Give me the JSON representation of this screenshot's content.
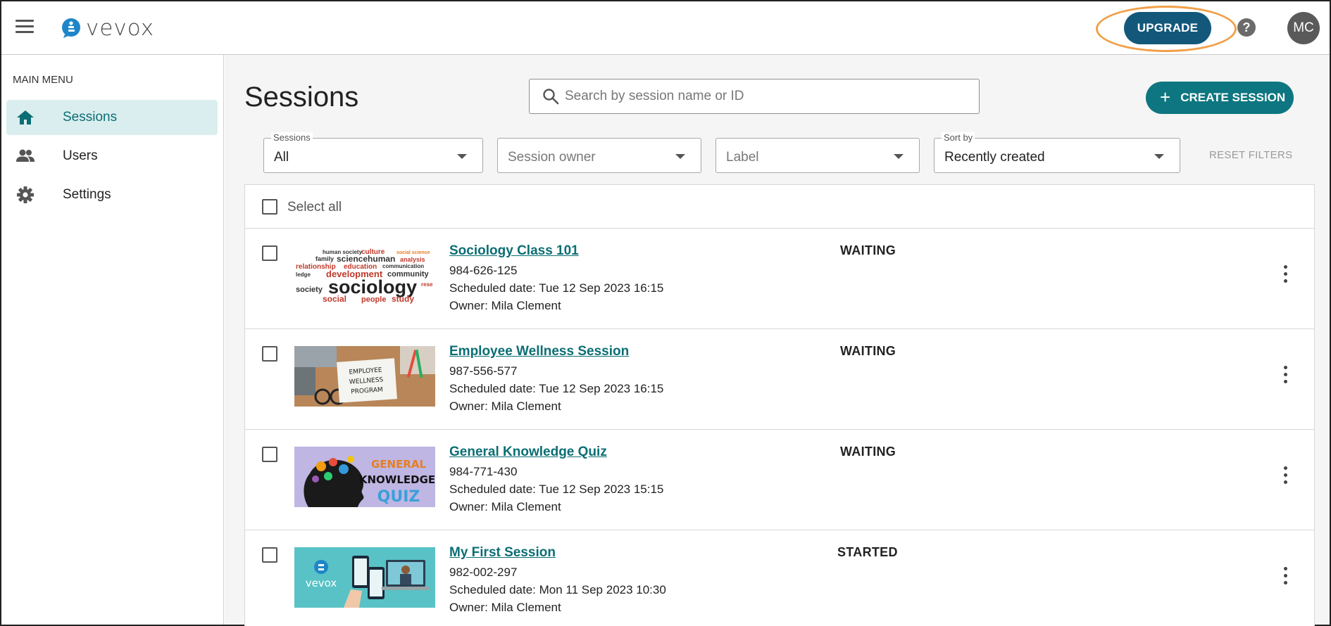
{
  "app": {
    "logo_text": "vevox"
  },
  "header": {
    "upgrade_label": "UPGRADE",
    "help_symbol": "?",
    "avatar_initials": "MC"
  },
  "sidebar": {
    "section_label": "MAIN MENU",
    "items": [
      {
        "label": "Sessions",
        "icon": "home-icon",
        "active": true
      },
      {
        "label": "Users",
        "icon": "users-icon",
        "active": false
      },
      {
        "label": "Settings",
        "icon": "gear-icon",
        "active": false
      }
    ]
  },
  "main": {
    "title": "Sessions",
    "search_placeholder": "Search by session name or ID",
    "create_label": "CREATE SESSION",
    "filters": [
      {
        "label": "Sessions",
        "value": "All"
      },
      {
        "label": "",
        "value": "Session owner"
      },
      {
        "label": "",
        "value": "Label"
      },
      {
        "label": "Sort by",
        "value": "Recently created"
      }
    ],
    "reset_label": "RESET FILTERS",
    "select_all_label": "Select all",
    "sessions": [
      {
        "title": "Sociology Class 101",
        "id": "984-626-125",
        "scheduled": "Scheduled date: Tue 12 Sep 2023 16:15",
        "owner": "Owner: Mila Clement",
        "status": "WAITING",
        "thumb_text": "sociology"
      },
      {
        "title": "Employee Wellness Session",
        "id": "987-556-577",
        "scheduled": "Scheduled date: Tue 12 Sep 2023 16:15",
        "owner": "Owner: Mila Clement",
        "status": "WAITING",
        "thumb_text": "EMPLOYEE WELLNESS PROGRAM"
      },
      {
        "title": "General Knowledge Quiz",
        "id": "984-771-430",
        "scheduled": "Scheduled date: Tue 12 Sep 2023 15:15",
        "owner": "Owner: Mila Clement",
        "status": "WAITING",
        "thumb_text": "GENERAL KNOWLEDGE QUIZ"
      },
      {
        "title": "My First Session",
        "id": "982-002-297",
        "scheduled": "Scheduled date: Mon 11 Sep 2023 10:30",
        "owner": "Owner: Mila Clement",
        "status": "STARTED",
        "thumb_text": "vevox"
      }
    ]
  },
  "colors": {
    "brand_teal": "#0e7680",
    "upgrade_blue": "#13587b",
    "highlight_ring": "#f0a04a",
    "active_nav_bg": "#dbeeef"
  }
}
